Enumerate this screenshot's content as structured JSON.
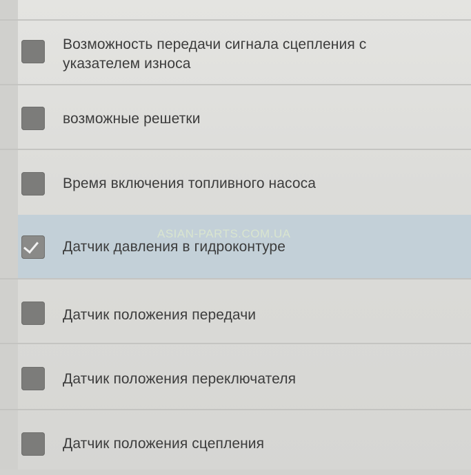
{
  "items": [
    {
      "label": "Возможность передачи сигнала сцепления с указателем износа",
      "checked": false
    },
    {
      "label": "возможные решетки",
      "checked": false
    },
    {
      "label": "Время включения топливного насоса",
      "checked": false
    },
    {
      "label": "Датчик давления в гидроконтуре",
      "checked": true
    },
    {
      "label": "Датчик положения передачи",
      "checked": false
    },
    {
      "label": "Датчик положения переключателя",
      "checked": false
    },
    {
      "label": "Датчик положения сцепления",
      "checked": false
    }
  ],
  "watermark": "ASIAN-PARTS.COM.UA",
  "colors": {
    "selected_row": "#c3d0d8",
    "checkbox": "#7c7c7a",
    "text": "#3c3c3c"
  }
}
